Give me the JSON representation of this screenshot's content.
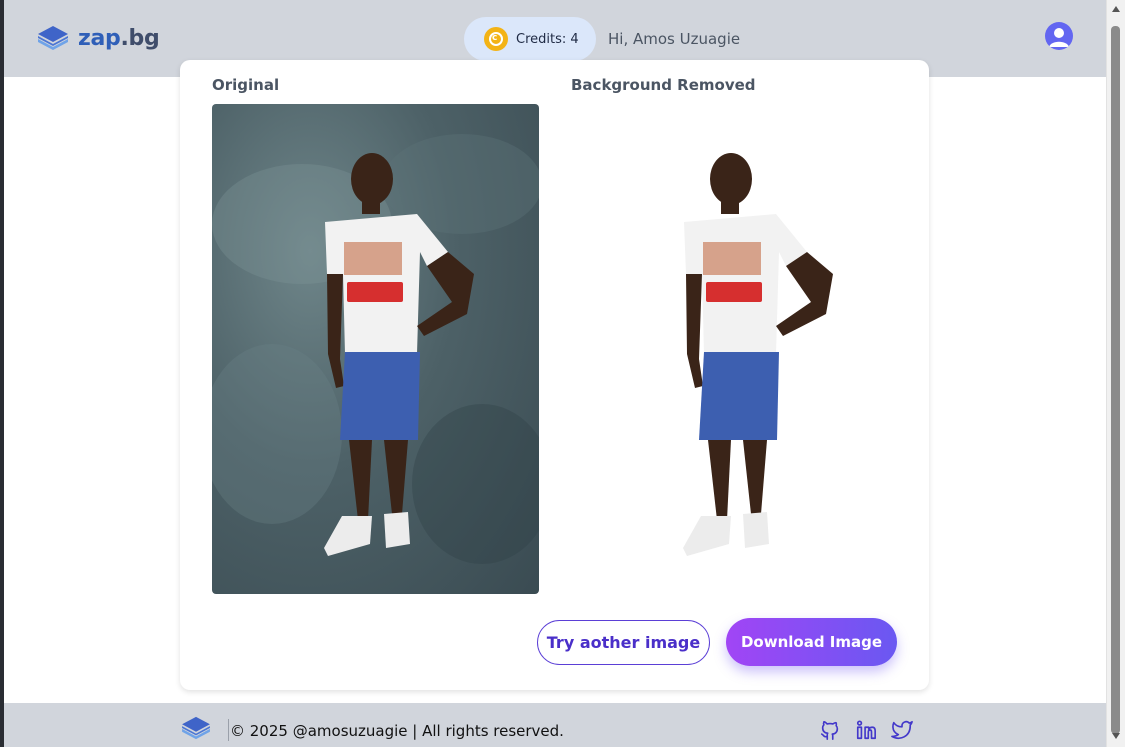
{
  "header": {
    "logo_text": "zap",
    "logo_suffix": ".bg",
    "credits_label": "Credits: 4",
    "greeting": "Hi, Amos Uzuagie"
  },
  "main": {
    "original_title": "Original",
    "removed_title": "Background Removed",
    "try_button": "Try aother image",
    "download_button": "Download Image"
  },
  "footer": {
    "copyright": "© 2025 @amosuzuagie | All rights reserved."
  },
  "icons": {
    "logo": "layers-icon",
    "credits": "coin-icon",
    "account": "user-avatar-icon",
    "social": [
      "github-icon",
      "linkedin-icon",
      "twitter-icon"
    ]
  },
  "colors": {
    "header_bg": "#d1d5dc",
    "brand": "#2f5fb8",
    "accent_start": "#a145f5",
    "accent_end": "#6a58f2",
    "credits_bg": "#dbe7fa"
  }
}
